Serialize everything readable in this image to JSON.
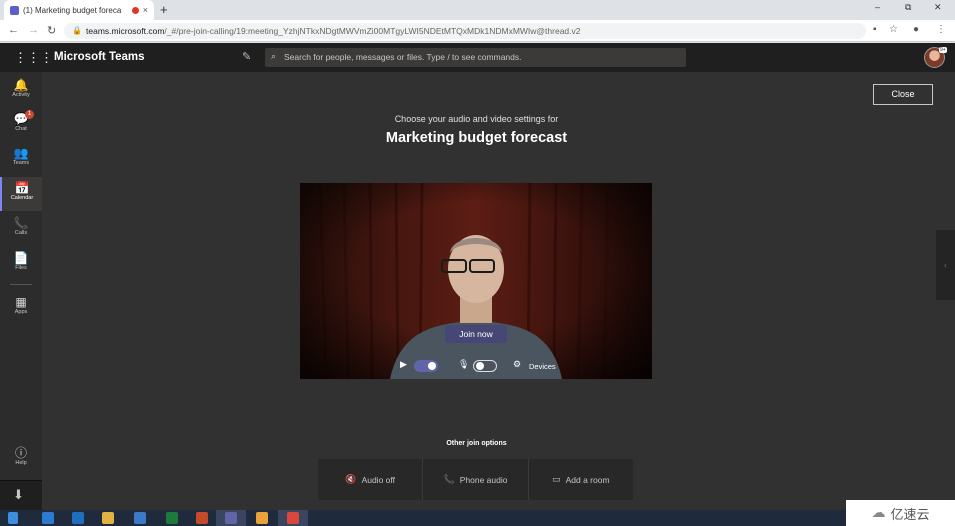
{
  "browser": {
    "tab_title": "(1) Marketing budget foreca",
    "tab_close": "×",
    "new_tab": "+",
    "url_host": "teams.microsoft.com",
    "url_path": "/_#/pre-join-calling/19:meeting_YzhjNTkxNDgtMWVmZi00MTgyLWI5NDEtMTQxMDk1NDMxMWIw@thread.v2",
    "window_controls": [
      "–",
      "⧉",
      "✕"
    ]
  },
  "teams": {
    "brand": "Microsoft Teams",
    "search_placeholder": "Search for people, messages or files. Type / to see commands.",
    "avatar_status": "9+"
  },
  "rail": [
    {
      "label": "Activity",
      "icon": "bell-icon",
      "glyph": "🔔"
    },
    {
      "label": "Chat",
      "icon": "chat-icon",
      "glyph": "💬",
      "badge": "1"
    },
    {
      "label": "Teams",
      "icon": "teams-icon",
      "glyph": "👥"
    },
    {
      "label": "Calendar",
      "icon": "calendar-icon",
      "glyph": "📅",
      "active": true
    },
    {
      "label": "Calls",
      "icon": "phone-icon",
      "glyph": "📞"
    },
    {
      "label": "Files",
      "icon": "files-icon",
      "glyph": "📄"
    },
    {
      "label": "Apps",
      "icon": "apps-icon",
      "glyph": "▦"
    },
    {
      "label": "Help",
      "icon": "help-icon",
      "glyph": "?"
    }
  ],
  "prejoin": {
    "close_label": "Close",
    "subtitle": "Choose your audio and video settings for",
    "meeting_title": "Marketing budget forecast",
    "join_label": "Join now",
    "devices_label": "Devices",
    "camera_on": true,
    "mic_on": false
  },
  "other_join": {
    "heading": "Other join options",
    "options": [
      {
        "label": "Audio off",
        "icon": "speaker-off-icon",
        "glyph": "🔇"
      },
      {
        "label": "Phone audio",
        "icon": "phone-icon",
        "glyph": "📞"
      },
      {
        "label": "Add a room",
        "icon": "cast-icon",
        "glyph": "▭"
      }
    ]
  },
  "watermark": {
    "text": "亿速云"
  },
  "colors": {
    "accent": "#6264a7",
    "join_button": "#464775",
    "app_bar": "#201f1f",
    "stage": "#323131"
  }
}
